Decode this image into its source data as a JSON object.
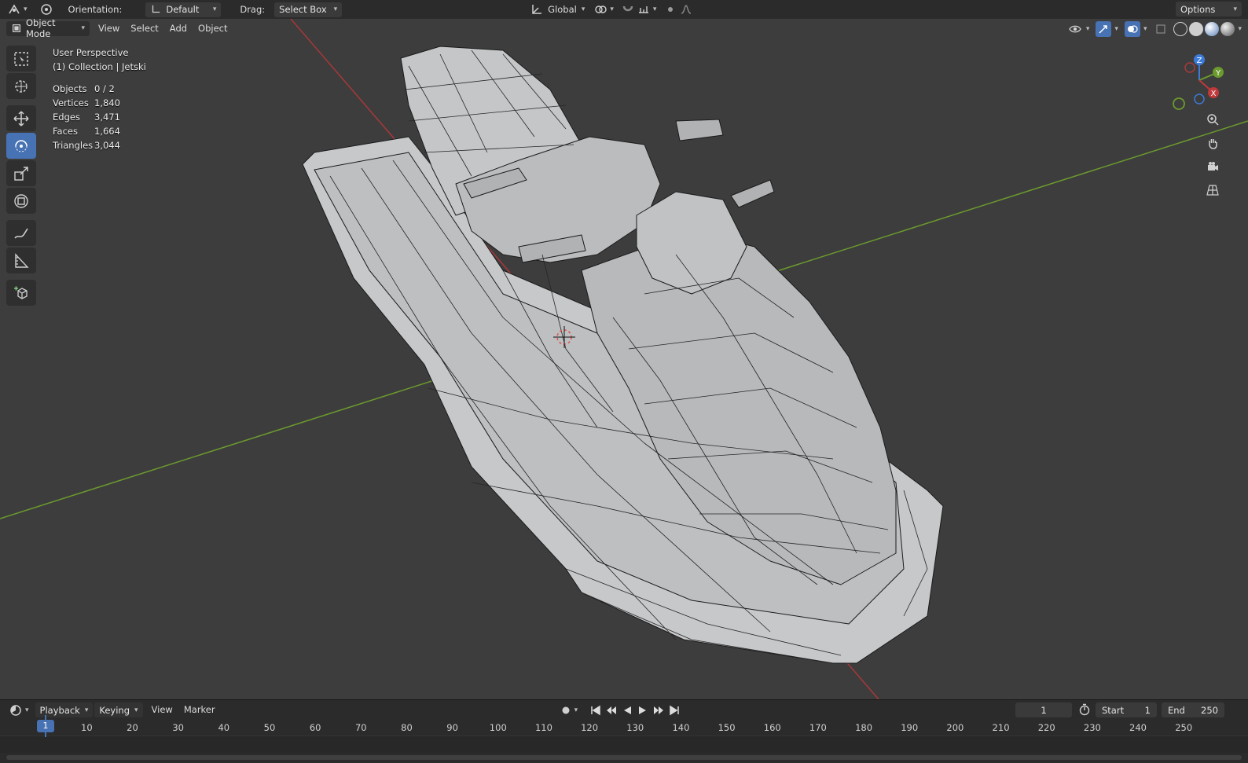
{
  "topbar": {
    "orientation_label": "Orientation:",
    "orientation_value": "Default",
    "drag_label": "Drag:",
    "drag_value": "Select Box",
    "transform_space": "Global",
    "options_label": "Options"
  },
  "viewport_header": {
    "mode": "Object Mode",
    "menus": [
      "View",
      "Select",
      "Add",
      "Object"
    ]
  },
  "overlay": {
    "perspective": "User Perspective",
    "collection": "(1) Collection | Jetski",
    "stats": [
      {
        "key": "Objects",
        "value": "0 / 2"
      },
      {
        "key": "Vertices",
        "value": "1,840"
      },
      {
        "key": "Edges",
        "value": "3,471"
      },
      {
        "key": "Faces",
        "value": "1,664"
      },
      {
        "key": "Triangles",
        "value": "3,044"
      }
    ]
  },
  "gizmo": {
    "x": "X",
    "y": "Y",
    "z": "Z"
  },
  "toolbar_icons": [
    "select-box-icon",
    "cursor-icon",
    "move-icon",
    "rotate-icon",
    "scale-icon",
    "transform-icon",
    "annotate-icon",
    "measure-icon",
    "add-cube-icon"
  ],
  "timeline": {
    "menus": [
      "Playback",
      "Keying",
      "View",
      "Marker"
    ],
    "current_frame": "1",
    "start_label": "Start",
    "start_value": "1",
    "end_label": "End",
    "end_value": "250",
    "ruler_labels": [
      "1",
      "10",
      "20",
      "30",
      "40",
      "50",
      "60",
      "70",
      "80",
      "90",
      "100",
      "110",
      "120",
      "130",
      "140",
      "150",
      "160",
      "170",
      "180",
      "190",
      "200",
      "210",
      "220",
      "230",
      "240",
      "250"
    ]
  },
  "colors": {
    "accent": "#4772b3",
    "viewport_bg": "#3d3d3d",
    "header_bg": "#2b2b2b",
    "axis_x": "#c0393b",
    "axis_y": "#6c9a2e",
    "axis_z": "#3d7bd9"
  }
}
